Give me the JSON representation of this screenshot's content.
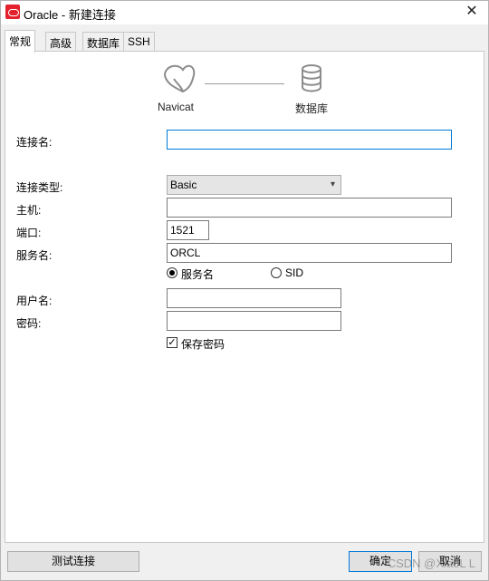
{
  "window": {
    "title": "Oracle - 新建连接",
    "close_glyph": "✕"
  },
  "tabs": [
    {
      "label": "常规",
      "active": true
    },
    {
      "label": "高级",
      "active": false
    },
    {
      "label": "数据库",
      "active": false
    },
    {
      "label": "SSH",
      "active": false
    }
  ],
  "illustration": {
    "left_label": "Navicat",
    "right_label": "数据库",
    "left_icon": "navicat-logo-icon",
    "right_icon": "database-icon"
  },
  "form": {
    "connection_name_label": "连接名:",
    "connection_name_value": "",
    "connection_type_label": "连接类型:",
    "connection_type_value": "Basic",
    "host_label": "主机:",
    "host_value": "",
    "port_label": "端口:",
    "port_value": "1521",
    "service_name_label": "服务名:",
    "service_name_value": "ORCL",
    "radio_service_name": "服务名",
    "radio_sid": "SID",
    "username_label": "用户名:",
    "username_value": "",
    "password_label": "密码:",
    "password_value": "",
    "save_password_label": "保存密码",
    "save_password_checked": true
  },
  "buttons": {
    "test_connection": "测试连接",
    "ok": "确定",
    "cancel": "取消"
  },
  "watermark": "CSDN @XiaoL L",
  "colors": {
    "accent": "#0078d7",
    "brand_red": "#e3222d"
  }
}
